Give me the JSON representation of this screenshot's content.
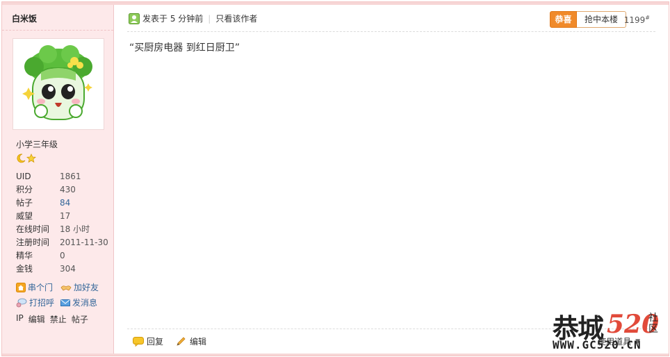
{
  "author": {
    "username": "白米饭",
    "rank": "小学三年级",
    "stats": [
      {
        "label": "UID",
        "value": "1861"
      },
      {
        "label": "积分",
        "value": "430"
      },
      {
        "label": "帖子",
        "value": "84"
      },
      {
        "label": "威望",
        "value": "17"
      },
      {
        "label": "在线时间",
        "value": "18 小时"
      },
      {
        "label": "注册时间",
        "value": "2011-11-30"
      },
      {
        "label": "精华",
        "value": "0"
      },
      {
        "label": "金钱",
        "value": "304"
      }
    ],
    "actions": {
      "visit": "串个门",
      "add_friend": "加好友",
      "greet": "打招呼",
      "message": "发消息"
    },
    "admin": [
      "IP",
      "编辑",
      "禁止",
      "帖子"
    ]
  },
  "post": {
    "posted": "发表于 5 分钟前",
    "only_author": "只看该作者",
    "congrats_tab": "恭喜",
    "grab_floor_tab": "抢中本楼",
    "floor_number": "1199",
    "floor_mark": "#",
    "content": "“买厨房电器 到红日厨卫”",
    "footer": {
      "reply": "回复",
      "edit": "编辑",
      "tools": "使用道具"
    }
  },
  "watermark": {
    "logo": "恭城",
    "number": "520",
    "side": "社区",
    "url": "WWW.GC520.CN"
  },
  "colors": {
    "sidebar_bg": "#fde9ea",
    "tab_orange": "#f08a2a",
    "link_blue": "#336699",
    "watermark_red": "#e14a3a"
  }
}
